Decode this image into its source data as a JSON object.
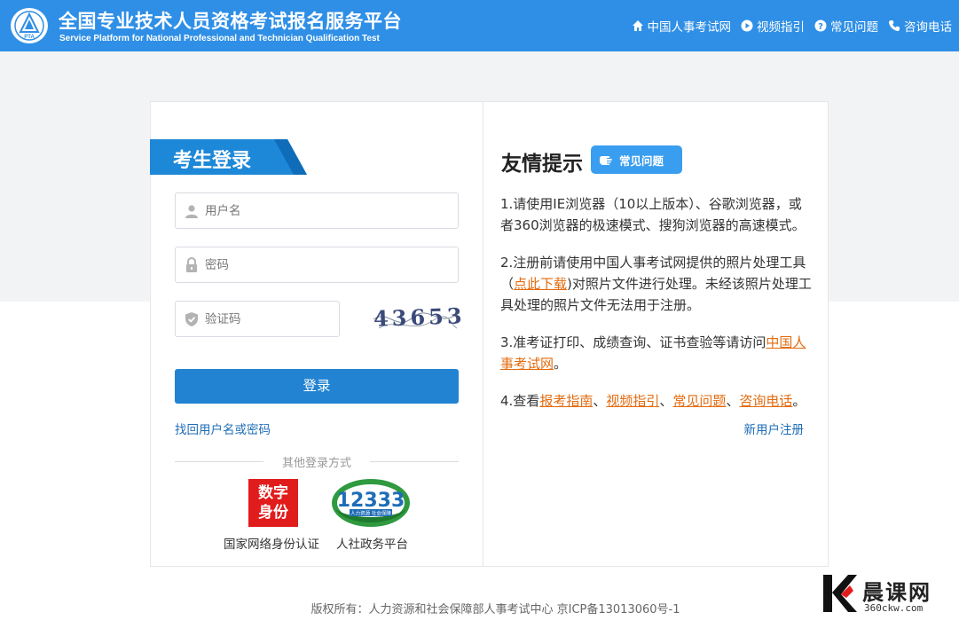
{
  "header": {
    "title_cn": "全国专业技术人员资格考试报名服务平台",
    "title_en": "Service Platform for National Professional and Technician Qualification Test",
    "logo_text": "PTA",
    "nav": [
      {
        "label": "中国人事考试网",
        "icon": "home-icon"
      },
      {
        "label": "视频指引",
        "icon": "play-icon"
      },
      {
        "label": "常见问题",
        "icon": "question-icon"
      },
      {
        "label": "咨询电话",
        "icon": "phone-icon"
      }
    ]
  },
  "login": {
    "title": "考生登录",
    "username_placeholder": "用户名",
    "password_placeholder": "密码",
    "captcha_placeholder": "验证码",
    "captcha_text": "43653",
    "submit_label": "登录",
    "forgot_label": "找回用户名或密码",
    "register_label": "新用户注册",
    "other_methods_label": "其他登录方式",
    "digital_id_text": "数字身份",
    "digital_id_caption": "国家网络身份认证",
    "logo_12333_text": "12333",
    "logo_12333_sub": "人力资源 社会保障",
    "platform_caption": "人社政务平台"
  },
  "tips": {
    "title": "友情提示",
    "faq_badge": "常见问题",
    "item1": "1.请使用IE浏览器（10以上版本）、谷歌浏览器，或者360浏览器的极速模式、搜狗浏览器的高速模式。",
    "item2_pre": "2.注册前请使用中国人事考试网提供的照片处理工具（",
    "item2_link": "点此下载",
    "item2_post": ")对照片文件进行处理。未经该照片处理工具处理的照片文件无法用于注册。",
    "item3_pre": "3.准考证打印、成绩查询、证书查验等请访问",
    "item3_link": "中国人事考试网",
    "item3_post": "。",
    "item4_pre": "4.查看",
    "item4_links": [
      "报考指南",
      "视频指引",
      "常见问题",
      "咨询电话"
    ],
    "item4_sep": "、",
    "item4_post": "。"
  },
  "footer": {
    "copyright": "版权所有：人力资源和社会保障部人事考试中心 京ICP备13013060号-1"
  },
  "watermark": {
    "name": "晨课网",
    "url": "360ckw.com"
  },
  "colors": {
    "header_bg": "#2f8fe6",
    "primary_button": "#2283d2",
    "link_blue": "#1f6db7",
    "link_orange": "#e36b0f",
    "digital_id_red": "#e11c1c"
  }
}
